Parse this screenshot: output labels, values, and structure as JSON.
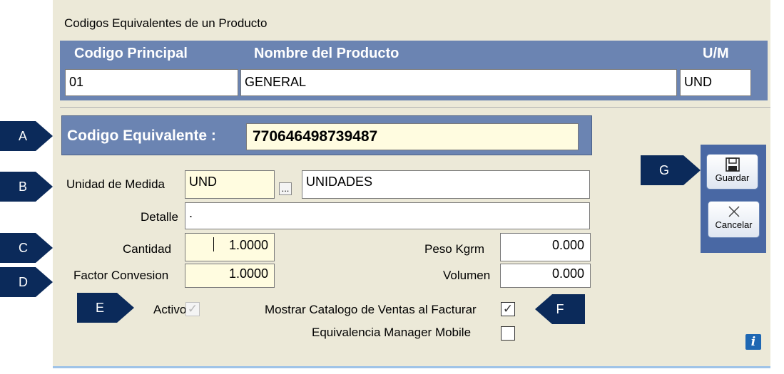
{
  "window": {
    "title": "Codigos Equivalentes de un Producto"
  },
  "header": {
    "col_codigo": "Codigo Principal",
    "col_nombre": "Nombre del Producto",
    "col_um": "U/M",
    "codigo_value": "01",
    "nombre_value": "GENERAL",
    "um_value": "UND"
  },
  "form": {
    "codigo_equivalente_label": "Codigo Equivalente :",
    "codigo_equivalente_value": "770646498739487",
    "unidad_medida_label": "Unidad de  Medida",
    "unidad_code": "UND",
    "unidad_browse": "...",
    "unidad_desc": "UNIDADES",
    "detalle_label": "Detalle",
    "detalle_value": ".",
    "cantidad_label": "Cantidad",
    "cantidad_value": "1.0000",
    "peso_label": "Peso  Kgrm",
    "peso_value": "0.000",
    "factor_label": "Factor  Convesion",
    "factor_value": "1.0000",
    "volumen_label": "Volumen",
    "volumen_value": "0.000",
    "activo_label": "Activo",
    "activo_checked": true,
    "mostrar_label": "Mostrar Catalogo de Ventas al Facturar",
    "mostrar_checked": true,
    "mobile_label": "Equivalencia Manager Mobile",
    "mobile_checked": false
  },
  "buttons": {
    "guardar": "Guardar",
    "cancelar": "Cancelar"
  },
  "callouts": {
    "a": "A",
    "b": "B",
    "c": "C",
    "d": "D",
    "e": "E",
    "f": "F",
    "g": "G"
  },
  "colors": {
    "header_bg": "#6B84B2",
    "callout_bg": "#0B2A5A",
    "field_yellow": "#FFFCE0",
    "panel_bg": "#ECE9D8"
  },
  "check_glyph": "✓"
}
